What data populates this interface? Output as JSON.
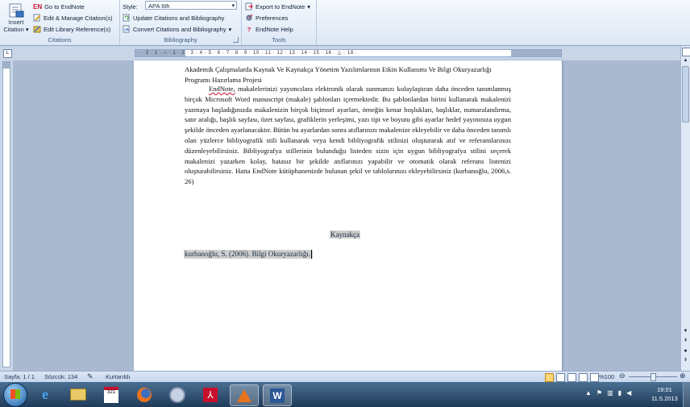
{
  "ribbon": {
    "citations": {
      "insert_line1": "Insert",
      "insert_line2": "Citation",
      "go_to_endnote": "Go to EndNote",
      "en_badge": "EN",
      "edit_manage": "Edit & Manage Citation(s)",
      "edit_library": "Edit Library Reference(s)",
      "group_label": "Citations"
    },
    "bibliography": {
      "style_label": "Style:",
      "style_value": "APA 6th",
      "update": "Update Citations and Bibliography",
      "convert": "Convert Citations and Bibliography",
      "group_label": "Bibliography"
    },
    "tools": {
      "export": "Export to EndNote",
      "preferences": "Preferences",
      "help": "EndNote Help",
      "group_label": "Tools"
    }
  },
  "ruler_numbers": "· 2 · 1 · ⌂ · 1 · 2 · 3 · 4 · 5 · 6 · 7 · 8 · 9 · 10 · 11 · 12 · 13 · 14 · 15 · 16 · △ · 18 ·",
  "document": {
    "title": "Akademik Çalışmalarda Kaynak Ve Kaynakça Yönetim Yazılımlarının Etkin Kullanımı Ve Bilgi Okuryazarlığı Programı Hazırlama Projesi",
    "para_first_word": "EndNote,",
    "para_rest": " makalelerinizi yayımcılara elektronik olarak sunmanızı kolaylaştıran daha önceden tanımlanmış birçok Microsoft Word manuscript (makale) şablonları içermektedir. Bu şablonlardan birini kullanarak makalenizi yazmaya başladığınızda makalenizin birçok biçimsel ayarları, örneğin kenar boşlukları, başlıklar, numaralandırma, satır aralığı, başlık sayfası, özet sayfası, grafiklerin yerleşimi, yazı tipi ve boyutu gibi ayarlar hedef yayınınıza uygun şekilde önceden ayarlanacaktır. Bütün bu ayarlardan sonra atıflarınızı makalenize ekleyebilir ve daha önceden tanımlı olan yüzlerce bibliyografik stili kullanarak veya kendi bibliyografik stilinizi oluşturarak atıf ve referanslarınızı düzenleyebilirsiniz. Bibliyografya stillerinin bulunduğu listeden sizin için uygun bibliyografya stilini seçerek makalenizi yazarken kolay, hatasız bir şekilde atıflarınızı yapabilir ve otomatik olarak referans listenizi oluşturabilirsiniz. Hatta EndNote kütüphanenizde bulunan şekil ve tablolarınızı ekleyebilirsiniz (kurbanoğlu, 2006,s. 26)",
    "heading": "Kaynakça",
    "reference": "kurbanoğlu, S. (2006). Bilgi Okuryazarlığı."
  },
  "status": {
    "page": "Sayfa: 1 / 1",
    "words": "Sözcük: 134",
    "recording": "Kurtarıldı",
    "zoom": "%100"
  },
  "taskbar": {
    "time": "19:01",
    "date": "11.5.2013",
    "calendar_day": "321"
  },
  "colors": {
    "ribbon_label": "#3c5a82",
    "page_bg": "#a9b9cf",
    "en_red": "#c8102e"
  }
}
